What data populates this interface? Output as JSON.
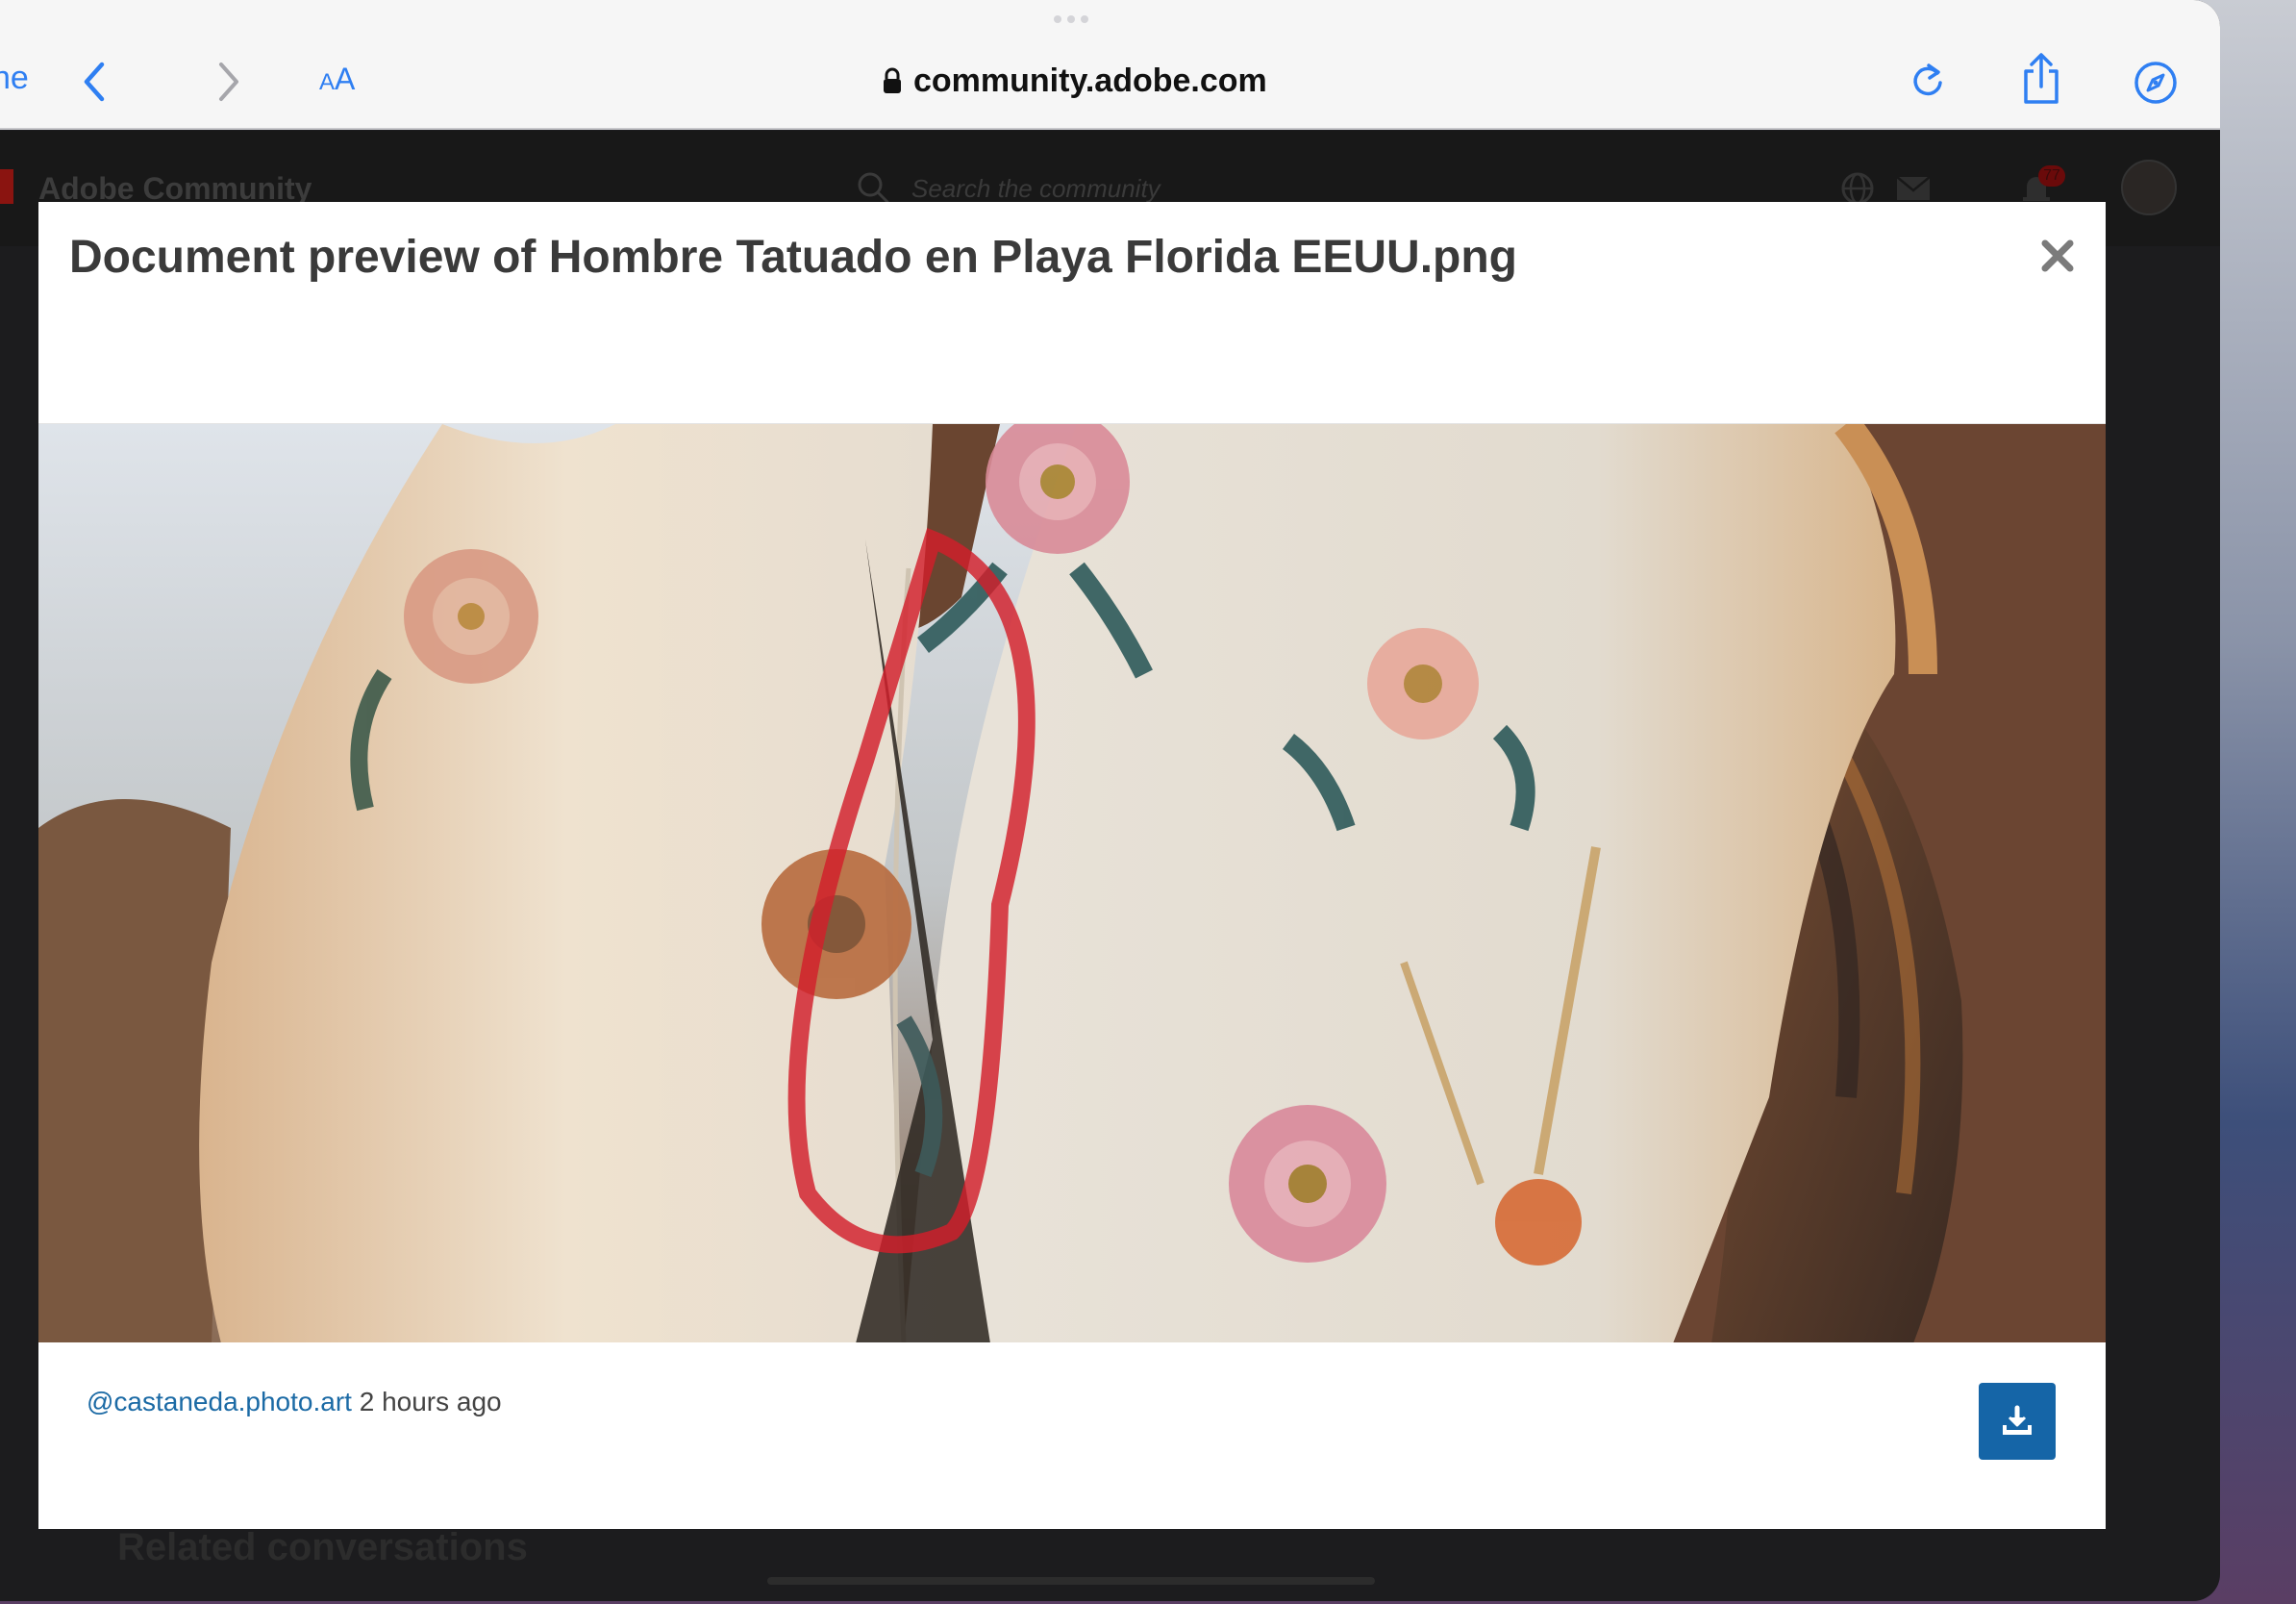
{
  "browser": {
    "done_label": "ne",
    "aa_small": "A",
    "aa_big": "A",
    "url": "community.adobe.com"
  },
  "site": {
    "title": "Adobe Community",
    "search_placeholder": "Search the community",
    "notification_count": "77",
    "related_title": "Related conversations"
  },
  "modal": {
    "title": "Document preview of Hombre Tatuado en Playa Florida EEUU.png",
    "author": "@castaneda.photo.art",
    "time": "2 hours ago"
  },
  "colors": {
    "accent": "#2f7ff2",
    "download_button": "#1565a7",
    "link": "#1b6aa5",
    "annotation": "#d21e2b"
  }
}
